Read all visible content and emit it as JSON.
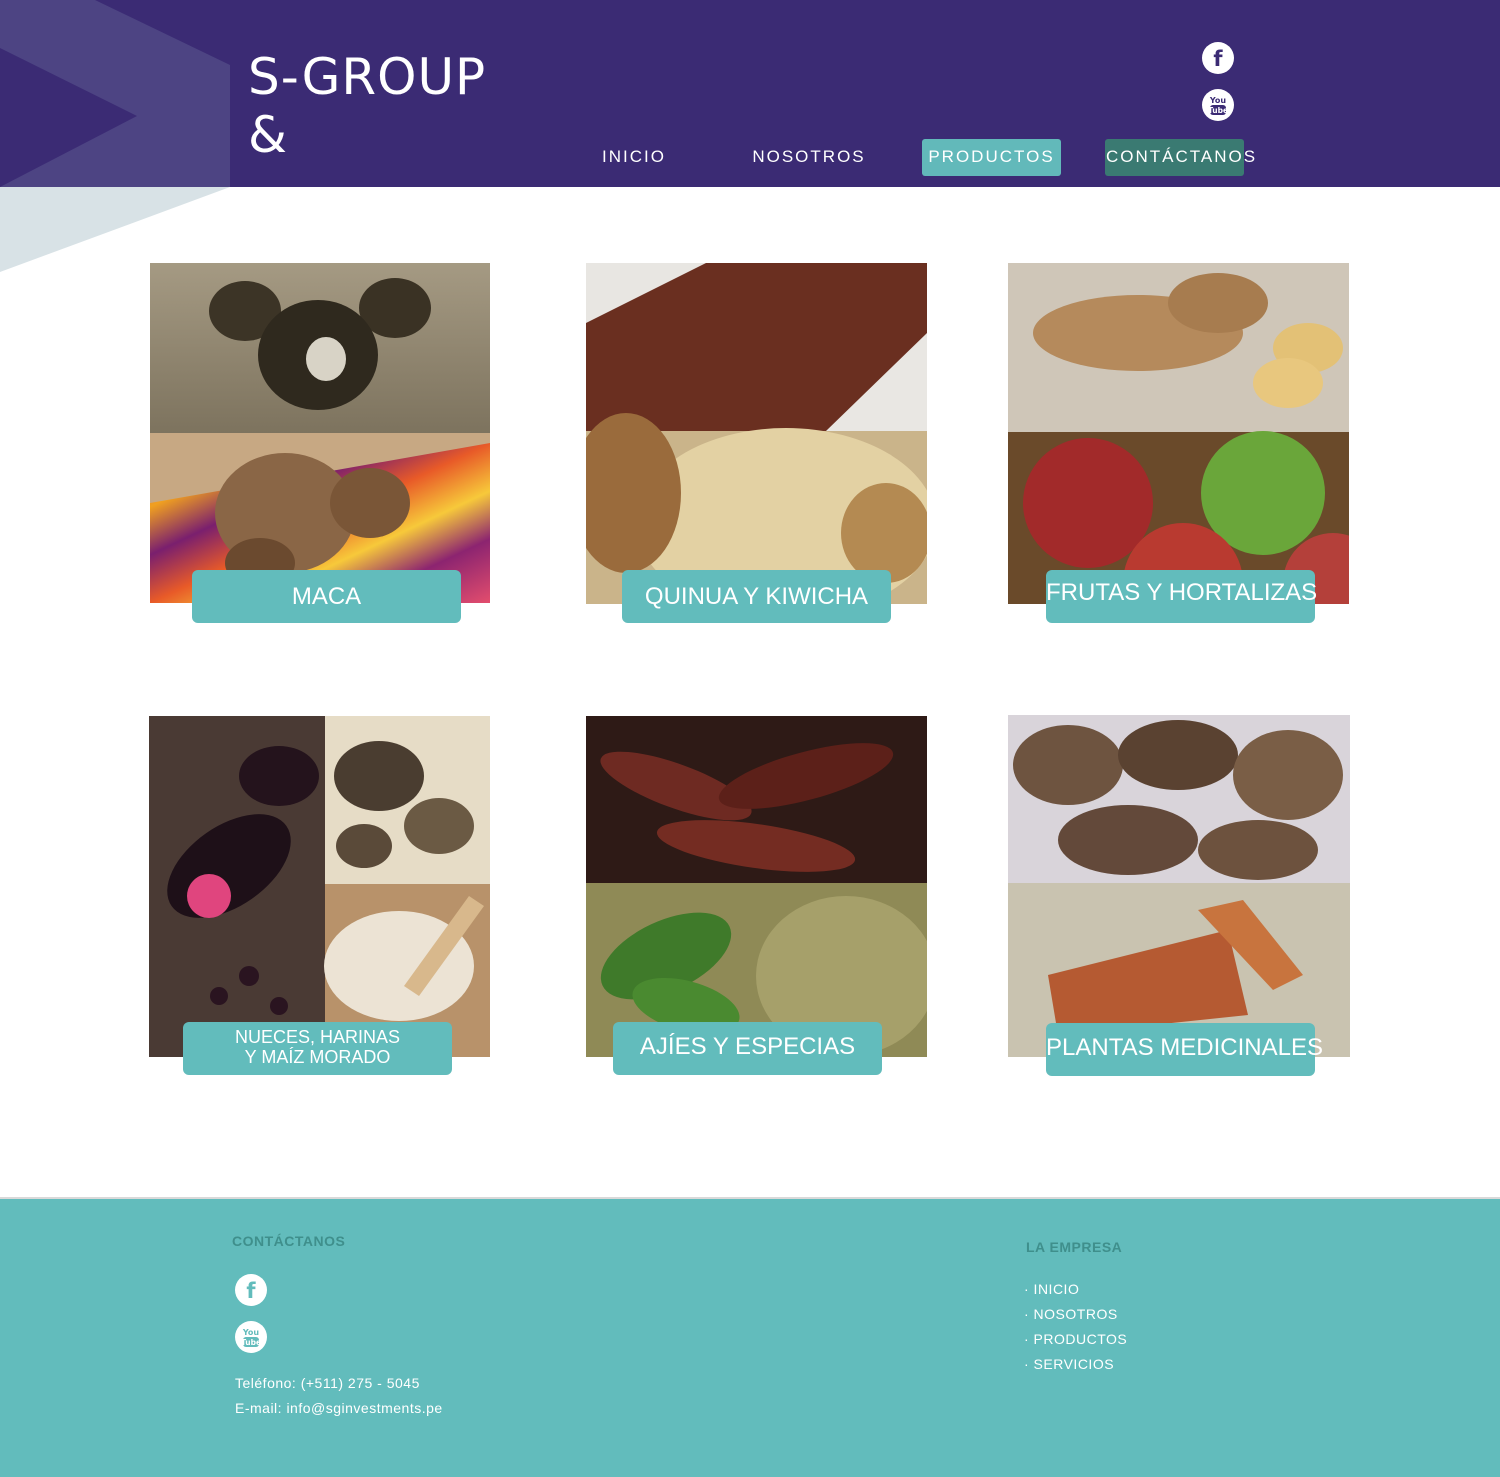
{
  "brand": {
    "name": "S-GROUP",
    "ampersand": "&"
  },
  "social": {
    "facebook_icon": "facebook-icon",
    "youtube_icon": "youtube-icon",
    "youtube_text_top": "You",
    "youtube_text_bottom": "Tube",
    "facebook_glyph": "f"
  },
  "nav": {
    "items": [
      {
        "label": "INICIO"
      },
      {
        "label": "NOSOTROS"
      },
      {
        "label": "PRODUCTOS"
      },
      {
        "label": "CONTÁCTANOS"
      }
    ],
    "active_color": "#62b9ba",
    "hover_color": "#3a7a72"
  },
  "colors": {
    "header_bg": "#3b2b74",
    "accent": "#62bcbc",
    "footer_heading": "#3f8f8c"
  },
  "products": [
    {
      "label": "MACA",
      "images": [
        "maca-roots-on-sand",
        "maca-roots-on-textile"
      ]
    },
    {
      "label": "QUINUA Y KIWICHA",
      "images": [
        "red-quinoa-scoop",
        "popped-kiwicha-bowl"
      ]
    },
    {
      "label": "FRUTAS Y HORTALIZAS",
      "images": [
        "ginger-root",
        "apples-bowl"
      ]
    },
    {
      "label_line1": "NUECES, HARINAS",
      "label_line2": "Y MAÍZ MORADO",
      "images": [
        "purple-corn",
        "brazil-nuts",
        "flour-bowl"
      ]
    },
    {
      "label": "AJÍES Y ESPECIAS",
      "images": [
        "dried-chili-peppers",
        "basil-and-oregano"
      ]
    },
    {
      "label": "PLANTAS MEDICINALES",
      "images": [
        "dried-roots",
        "cinnamon-bark"
      ]
    }
  ],
  "footer": {
    "contact_heading": "CONTÁCTANOS",
    "phone": "Teléfono: (+511) 275 - 5045",
    "email": "E-mail: info@sginvestments.pe",
    "company_heading": "LA EMPRESA",
    "links": [
      "· INICIO",
      "· NOSOTROS",
      "· PRODUCTOS",
      "· SERVICIOS"
    ]
  }
}
